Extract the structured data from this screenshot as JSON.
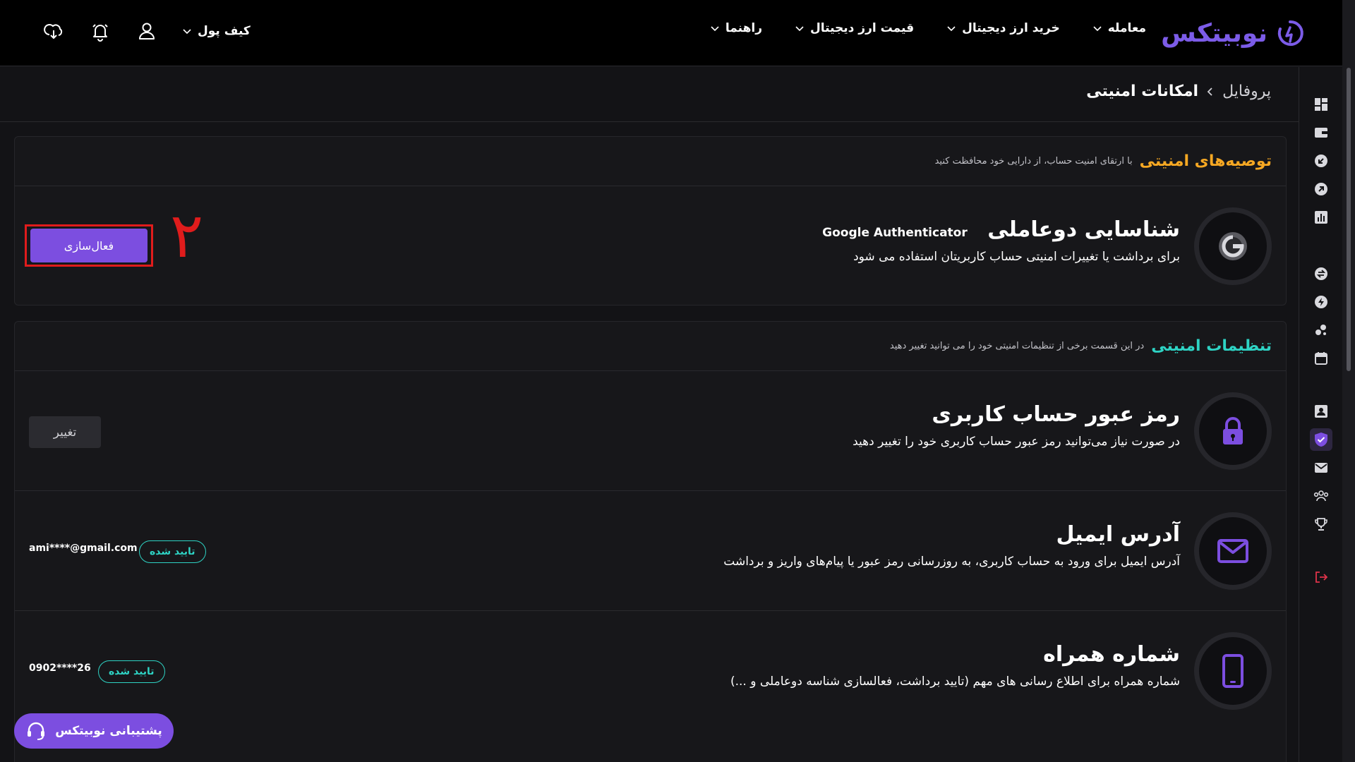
{
  "header": {
    "logo_text": "نوبیتکس",
    "nav": [
      "معامله",
      "خرید ارز دیجیتال",
      "قیمت ارز دیجیتال",
      "راهنما"
    ],
    "wallet_label": "کیف پول",
    "icons": [
      "user-icon",
      "bell-icon",
      "download-icon"
    ]
  },
  "breadcrumb": {
    "parent": "پروفایل",
    "current": "امکانات امنیتی"
  },
  "recommendations": {
    "title": "توصیه‌های امنیتی",
    "subtitle": "با ارتقای امنیت حساب، از دارایی خود محافظت کنید",
    "item": {
      "title": "شناسایی دوعاملی",
      "badge": "Google Authenticator",
      "description": "برای برداشت یا تغییرات امنیتی حساب کاربریتان استفاده می شود",
      "button": "فعال‌سازی",
      "annotation": "۲"
    }
  },
  "settings": {
    "title": "تنظیمات امنیتی",
    "subtitle": "در این قسمت برخی از تنظیمات امنیتی خود را می توانید تغییر دهید",
    "password": {
      "title": "رمز عبور حساب کاربری",
      "description": "در صورت نیاز می‌توانید رمز عبور حساب کاربری خود را تغییر دهید",
      "button": "تغییر"
    },
    "email": {
      "title": "آدرس ایمیل",
      "description": "آدرس ایمیل برای ورود به حساب کاربری، به روزرسانی رمز عبور یا پیام‌های واریز و برداشت",
      "status": "تایید شده",
      "value": "ami****@gmail.com"
    },
    "phone": {
      "title": "شماره همراه",
      "description": "شماره همراه برای اطلاع رسانی های مهم (تایید برداشت، فعالسازی شناسه دوعاملی و ...)",
      "status": "تایید شده",
      "value": "0902****26"
    }
  },
  "support": {
    "label": "پشتیبانی نوبیتکس"
  },
  "colors": {
    "accent": "#7c4ee0",
    "orange": "#f6a823",
    "teal": "#2ed3c4",
    "annotation_red": "#e01c1c"
  }
}
